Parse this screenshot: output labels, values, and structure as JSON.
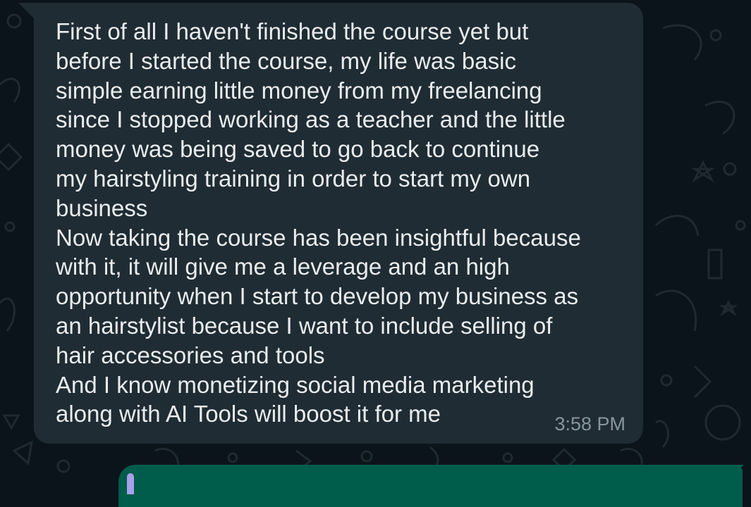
{
  "message": {
    "text": "First of all I haven't finished the course yet but\nbefore I started the course, my life was basic\nsimple earning little money from my freelancing\nsince I stopped working as a teacher and the little\nmoney was being saved to go back to continue\nmy hairstyling training in order to start my own\nbusiness\nNow taking the course has been insightful because\nwith it, it will give me a leverage and an high\nopportunity when I start to develop my business as\nan hairstylist because I want to include selling of\nhair accessories and tools\nAnd I know monetizing social media marketing\nalong with AI Tools will boost it for me",
    "time": "3:58 PM"
  },
  "colors": {
    "background": "#0b141a",
    "incoming_bubble": "#202c33",
    "outgoing_bubble": "#005c4b",
    "text": "#e9edef",
    "timestamp": "#8696a0"
  }
}
